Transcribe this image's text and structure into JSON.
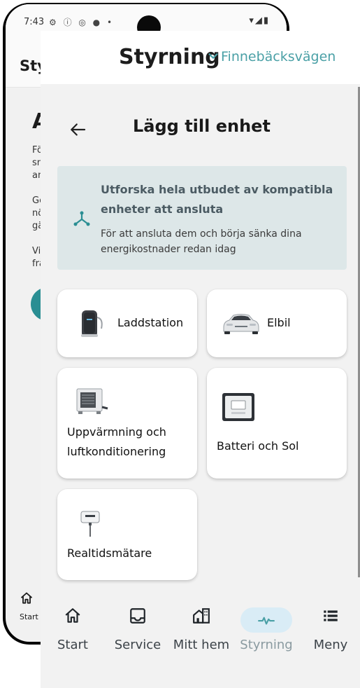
{
  "status_bar": {
    "time": "7:43",
    "left_icons": "⚙ ⓘ ◎ ● •",
    "right_icons": "▾◢▮"
  },
  "background_screen": {
    "header_title": "Styr",
    "title": "A",
    "para1": [
      "Fö",
      "sn",
      "an"
    ],
    "para2": [
      "Ge",
      "nö",
      "gä"
    ],
    "para3": [
      "Vi",
      "frå"
    ],
    "nav_label": "Start"
  },
  "header": {
    "title": "Styrning",
    "location": "Finnebäcksvägen"
  },
  "page": {
    "title": "Lägg till enhet"
  },
  "info_card": {
    "title": "Utforska hela utbudet av kompatibla enheter att ansluta",
    "subtitle": "För att ansluta dem och börja sänka dina energikostnader redan idag"
  },
  "devices": [
    {
      "label": "Laddstation",
      "icon": "charging-station-icon"
    },
    {
      "label": "Elbil",
      "icon": "electric-car-icon"
    },
    {
      "label": "Uppvärmning och luftkonditionering",
      "icon": "heat-pump-icon"
    },
    {
      "label": "Batteri och Sol",
      "icon": "battery-icon"
    },
    {
      "label": "Realtidsmätare",
      "icon": "realtime-meter-icon"
    }
  ],
  "bottom_nav": [
    {
      "label": "Start",
      "icon": "home-icon",
      "active": false
    },
    {
      "label": "Service",
      "icon": "service-icon",
      "active": false
    },
    {
      "label": "Mitt hem",
      "icon": "house-grid-icon",
      "active": false
    },
    {
      "label": "Styrning",
      "icon": "activity-icon",
      "active": true
    },
    {
      "label": "Meny",
      "icon": "list-icon",
      "active": false
    }
  ],
  "colors": {
    "accent": "#4aa0a6",
    "info_card_bg": "#dde7e8",
    "active_pill": "#d9ecf6"
  }
}
